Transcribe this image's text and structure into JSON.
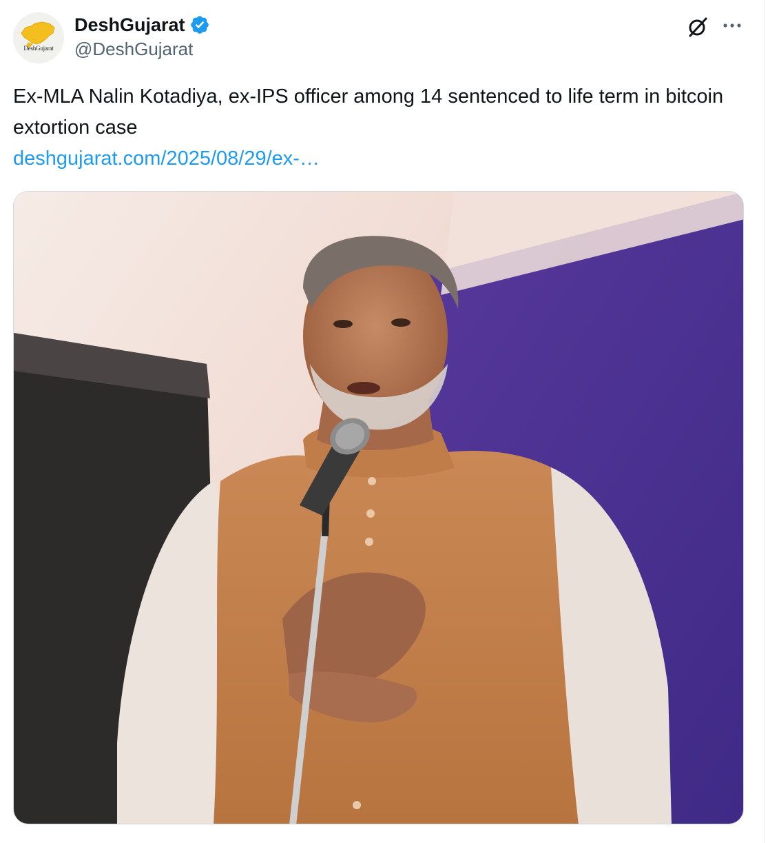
{
  "tweet": {
    "author": {
      "display_name": "DeshGujarat",
      "handle": "@DeshGujarat",
      "verified": true,
      "avatar_text": "DeshGujarat",
      "avatar_icon": "gujarat-map-logo"
    },
    "text": "Ex-MLA Nalin Kotadiya, ex-IPS officer among 14 sentenced to life term in bitcoin extortion case",
    "link_text": "deshgujarat.com/2025/08/29/ex-…",
    "media": {
      "type": "photo"
    },
    "actions": {
      "grok_icon": "grok-icon",
      "more_icon": "more-options-icon"
    }
  },
  "colors": {
    "text_primary": "#0f1419",
    "text_secondary": "#536471",
    "link": "#1d9bf0",
    "verified": "#1d9bf0",
    "border": "#cfd9de"
  }
}
